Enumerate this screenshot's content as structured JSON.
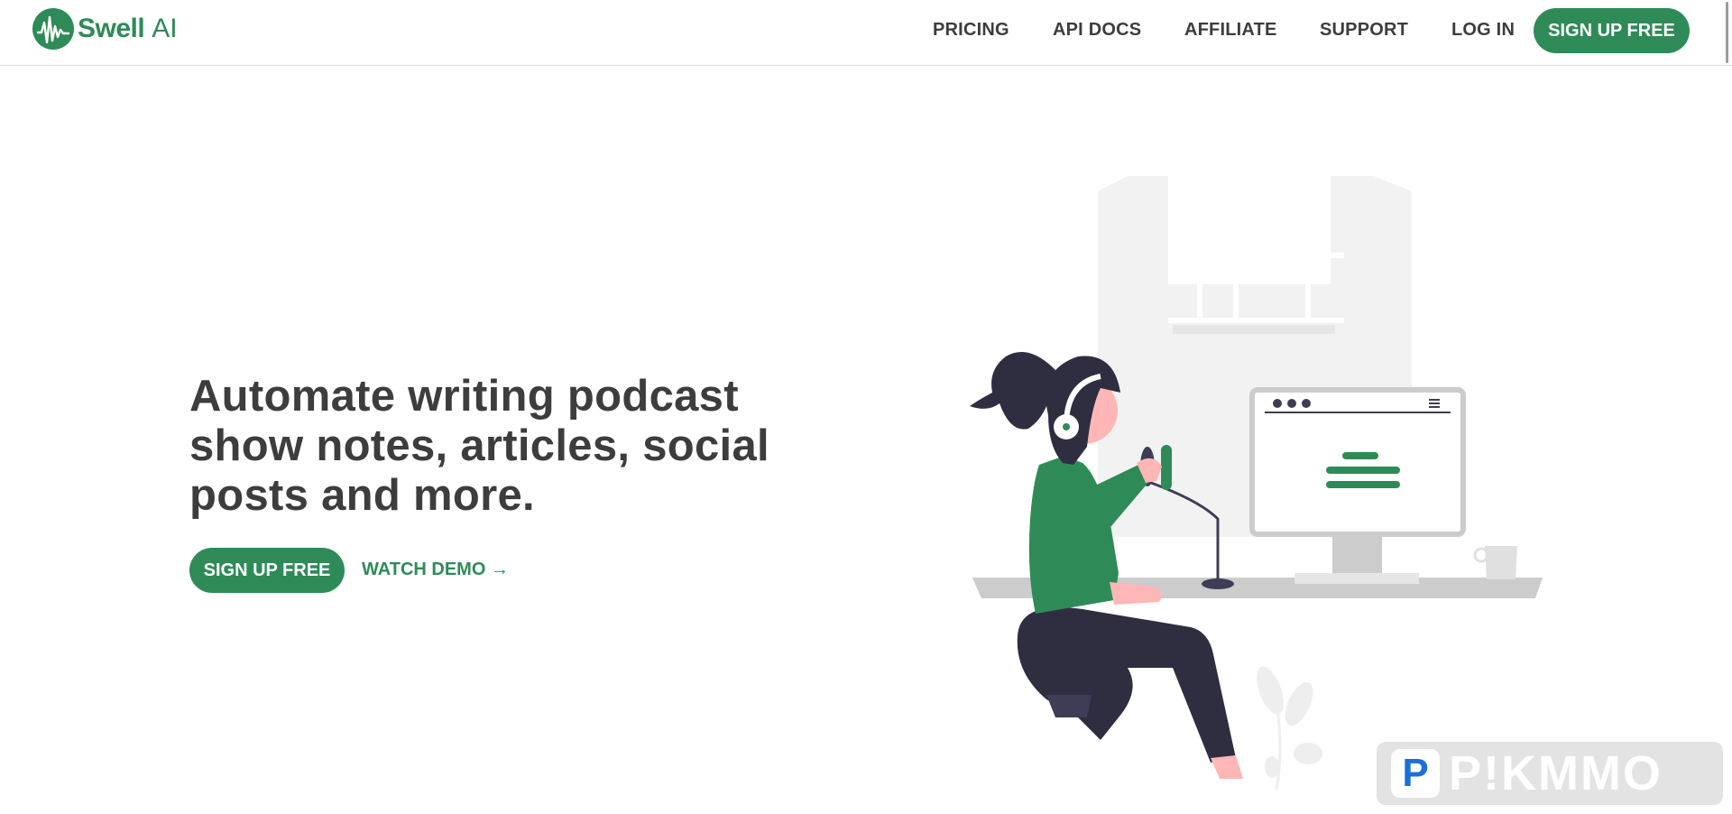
{
  "brand": {
    "name_bold": "Swell",
    "name_light": "AI",
    "accent_color": "#2e8b57"
  },
  "nav": {
    "links": [
      "PRICING",
      "API DOCS",
      "AFFILIATE",
      "SUPPORT",
      "LOG IN"
    ],
    "cta": "SIGN UP FREE"
  },
  "hero": {
    "title": "Automate writing podcast show notes, articles, social posts and more.",
    "cta_label": "SIGN UP FREE",
    "demo_label": "WATCH DEMO →"
  },
  "illustration": {
    "description_icon": "podcaster-illustration"
  },
  "watermark": {
    "text": "P!KMMO",
    "badge": "P"
  }
}
